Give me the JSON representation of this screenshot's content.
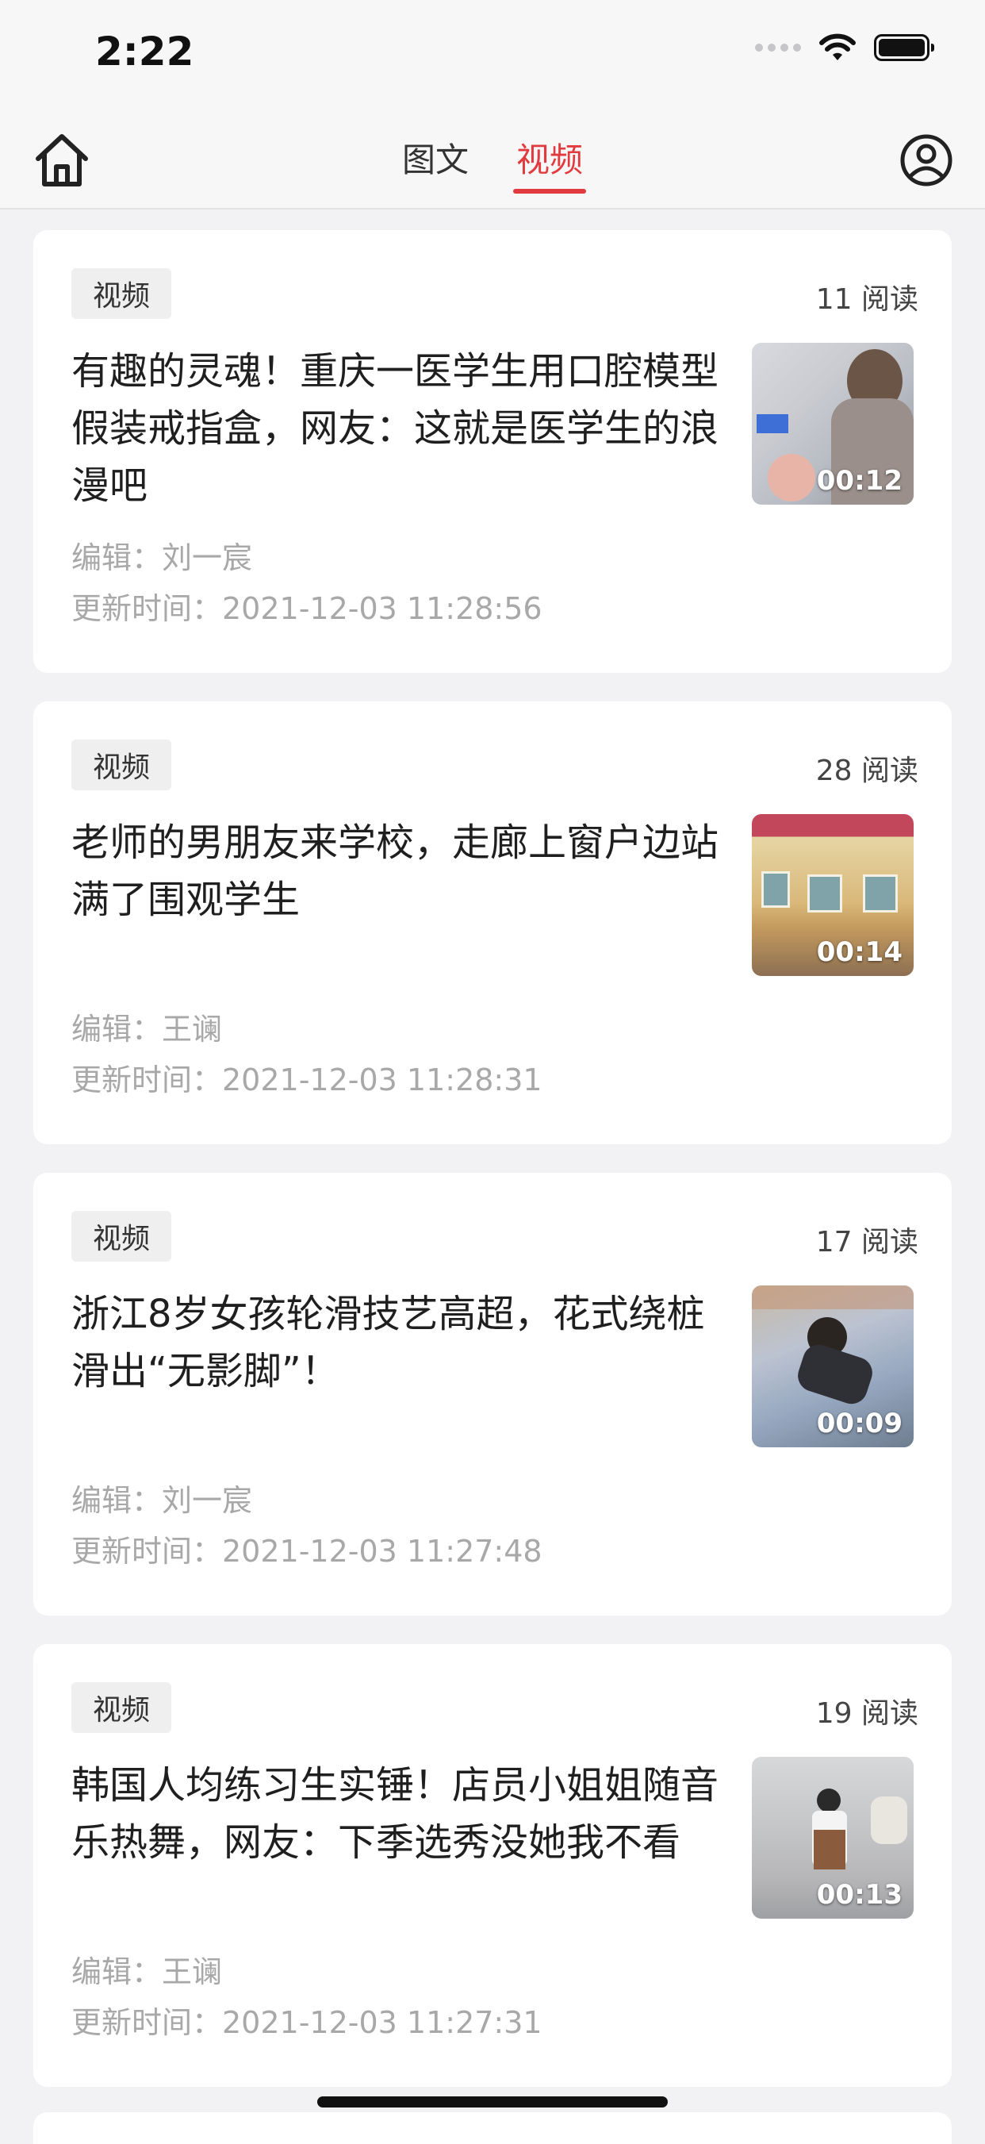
{
  "status_bar": {
    "time": "2:22"
  },
  "nav": {
    "tabs": [
      {
        "label": "图文",
        "active": false
      },
      {
        "label": "视频",
        "active": true
      }
    ]
  },
  "colors": {
    "accent": "#e23b3f",
    "background": "#f2f2f4",
    "card": "#ffffff",
    "meta_text": "#a8a8a8"
  },
  "icons": {
    "home": "home-icon",
    "profile": "user-icon",
    "wifi": "wifi-icon",
    "battery": "battery-icon"
  },
  "articles": [
    {
      "tag": "视频",
      "reads": "11 阅读",
      "title": "有趣的灵魂！重庆一医学生用口腔模型假装戒指盒，网友：这就是医学生的浪漫吧",
      "duration": "00:12",
      "editor": "编辑：刘一宸",
      "updated": "更新时间：2021-12-03 11:28:56"
    },
    {
      "tag": "视频",
      "reads": "28 阅读",
      "title": "老师的男朋友来学校，走廊上窗户边站满了围观学生",
      "duration": "00:14",
      "editor": "编辑：王谰",
      "updated": "更新时间：2021-12-03 11:28:31"
    },
    {
      "tag": "视频",
      "reads": "17 阅读",
      "title": "浙江8岁女孩轮滑技艺高超，花式绕桩滑出“无影脚”！",
      "duration": "00:09",
      "editor": "编辑：刘一宸",
      "updated": "更新时间：2021-12-03 11:27:48"
    },
    {
      "tag": "视频",
      "reads": "19 阅读",
      "title": "韩国人均练习生实锤！店员小姐姐随音乐热舞，网友：下季选秀没她我不看",
      "duration": "00:13",
      "editor": "编辑：王谰",
      "updated": "更新时间：2021-12-03 11:27:31"
    }
  ]
}
